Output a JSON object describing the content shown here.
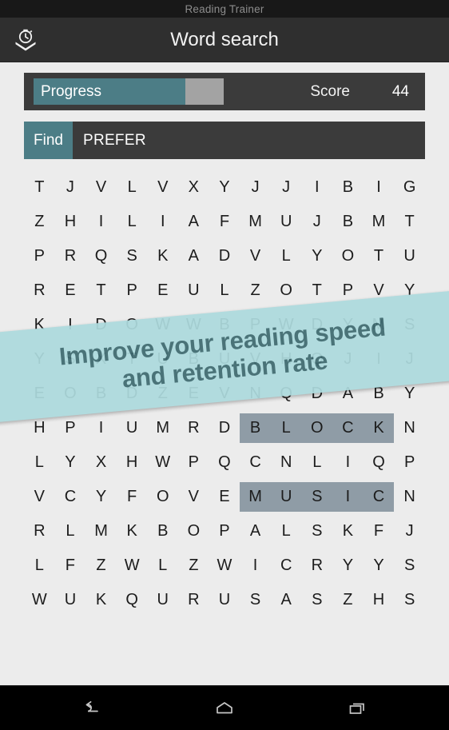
{
  "status_bar": {
    "title": "Reading Trainer"
  },
  "action_bar": {
    "title": "Word search",
    "icon": "stopwatch-book-icon"
  },
  "progress": {
    "label": "Progress",
    "percent": 80,
    "fill_color": "#4c7d86",
    "track_color": "#a3a3a3",
    "score_label": "Score",
    "score_value": "44"
  },
  "find": {
    "tag": "Find",
    "word": "PREFER"
  },
  "grid": {
    "columns": 13,
    "rows": [
      [
        "T",
        "J",
        "V",
        "L",
        "V",
        "X",
        "Y",
        "J",
        "J",
        "I",
        "B",
        "I",
        "G"
      ],
      [
        "Z",
        "H",
        "I",
        "L",
        "I",
        "A",
        "F",
        "M",
        "U",
        "J",
        "B",
        "M",
        "T"
      ],
      [
        "P",
        "R",
        "Q",
        "S",
        "K",
        "A",
        "D",
        "V",
        "L",
        "Y",
        "O",
        "T",
        "U"
      ],
      [
        "R",
        "E",
        "T",
        "P",
        "E",
        "U",
        "L",
        "Z",
        "O",
        "T",
        "P",
        "V",
        "Y"
      ],
      [
        "K",
        "I",
        "D",
        "O",
        "W",
        "W",
        "B",
        "P",
        "W",
        "D",
        "Y",
        "M",
        "S"
      ],
      [
        "Y",
        "S",
        "X",
        "T",
        "U",
        "B",
        "U",
        "V",
        "H",
        "Q",
        "J",
        "I",
        "J"
      ],
      [
        "E",
        "O",
        "B",
        "D",
        "Z",
        "E",
        "V",
        "N",
        "Q",
        "D",
        "A",
        "B",
        "Y"
      ],
      [
        "H",
        "P",
        "I",
        "U",
        "M",
        "R",
        "D",
        "B",
        "L",
        "O",
        "C",
        "K",
        "N"
      ],
      [
        "L",
        "Y",
        "X",
        "H",
        "W",
        "P",
        "Q",
        "C",
        "N",
        "L",
        "I",
        "Q",
        "P"
      ],
      [
        "V",
        "C",
        "Y",
        "F",
        "O",
        "V",
        "E",
        "M",
        "U",
        "S",
        "I",
        "C",
        "N"
      ],
      [
        "R",
        "L",
        "M",
        "K",
        "B",
        "O",
        "P",
        "A",
        "L",
        "S",
        "K",
        "F",
        "J"
      ],
      [
        "L",
        "F",
        "Z",
        "W",
        "L",
        "Z",
        "W",
        "I",
        "C",
        "R",
        "Y",
        "Y",
        "S"
      ],
      [
        "W",
        "U",
        "K",
        "Q",
        "U",
        "R",
        "U",
        "S",
        "A",
        "S",
        "Z",
        "H",
        "S"
      ]
    ],
    "highlights": [
      {
        "word": "BLOCK",
        "row": 7,
        "start": 7,
        "end": 11
      },
      {
        "word": "MUSIC",
        "row": 9,
        "start": 7,
        "end": 11
      }
    ],
    "highlight_color": "#8f9ca6"
  },
  "promo": {
    "line1": "Improve your reading speed",
    "line2": "and retention rate",
    "background": "#addadd",
    "text_color": "#3e6a70"
  },
  "nav_bar": {
    "back": "back-icon",
    "home": "home-icon",
    "recents": "recents-icon"
  }
}
